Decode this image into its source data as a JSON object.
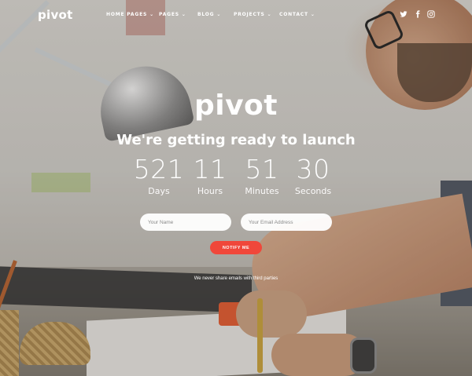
{
  "nav": {
    "logo": "pivot",
    "items": [
      {
        "label": "HOME PAGES",
        "has_dropdown": true
      },
      {
        "label": "PAGES",
        "has_dropdown": true
      },
      {
        "label": "BLOG",
        "has_dropdown": true
      },
      {
        "label": "PROJECTS",
        "has_dropdown": true
      },
      {
        "label": "CONTACT",
        "has_dropdown": true
      }
    ],
    "social_icons": [
      "twitter-icon",
      "facebook-icon",
      "instagram-icon"
    ]
  },
  "hero": {
    "brand": "pivot",
    "headline": "We're getting ready to launch",
    "countdown": [
      {
        "value": "521",
        "label": "Days"
      },
      {
        "value": "11",
        "label": "Hours"
      },
      {
        "value": "51",
        "label": "Minutes"
      },
      {
        "value": "30",
        "label": "Seconds"
      }
    ],
    "form": {
      "name_placeholder": "Your Name",
      "email_placeholder": "Your Email Address",
      "submit_label": "NOTIFY ME"
    },
    "disclaimer": "We never share emails with third parties"
  },
  "colors": {
    "accent": "#f0473a",
    "text": "#ffffff"
  }
}
